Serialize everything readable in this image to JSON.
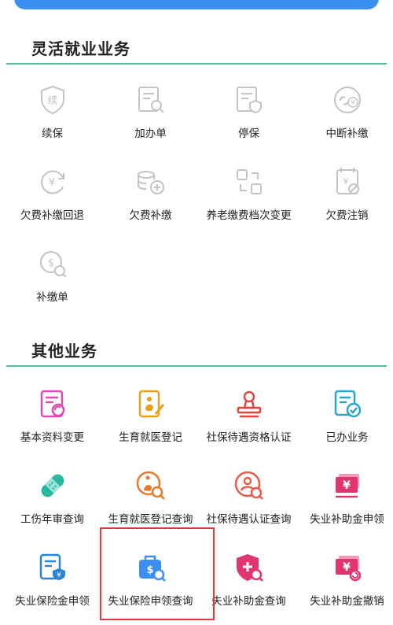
{
  "sections": {
    "flexible": {
      "title": "灵活就业业务",
      "items": [
        {
          "label": "续保",
          "icon": "renew-shield-icon"
        },
        {
          "label": "加办单",
          "icon": "add-form-search-icon"
        },
        {
          "label": "停保",
          "icon": "stop-insurance-icon"
        },
        {
          "label": "中断补缴",
          "icon": "interrupt-payment-icon"
        },
        {
          "label": "欠费补缴回退",
          "icon": "arrears-rollback-icon"
        },
        {
          "label": "欠费补缴",
          "icon": "arrears-payment-icon"
        },
        {
          "label": "养老缴费档次变更",
          "icon": "pension-level-change-icon"
        },
        {
          "label": "欠费注销",
          "icon": "arrears-cancel-icon"
        },
        {
          "label": "补缴单",
          "icon": "payment-form-icon"
        }
      ]
    },
    "other": {
      "title": "其他业务",
      "items": [
        {
          "label": "基本资料变更",
          "icon": "profile-change-icon"
        },
        {
          "label": "生育就医登记",
          "icon": "maternity-register-icon"
        },
        {
          "label": "社保待遇资格认证",
          "icon": "qualification-stamp-icon"
        },
        {
          "label": "已办业务",
          "icon": "done-business-icon"
        },
        {
          "label": "工伤年审查询",
          "icon": "injury-bandage-icon"
        },
        {
          "label": "生育就医登记查询",
          "icon": "maternity-query-icon"
        },
        {
          "label": "社保待遇认证查询",
          "icon": "certification-query-icon"
        },
        {
          "label": "失业补助金申领",
          "icon": "unemployment-subsidy-apply-icon"
        },
        {
          "label": "失业保险金申领",
          "icon": "unemployment-insurance-apply-icon"
        },
        {
          "label": "失业保险申领查询",
          "icon": "unemployment-insurance-query-icon"
        },
        {
          "label": "失业补助金查询",
          "icon": "unemployment-subsidy-query-icon"
        },
        {
          "label": "失业补助金撤销",
          "icon": "unemployment-subsidy-cancel-icon"
        }
      ]
    }
  },
  "colors": {
    "accent_bar": "#3b8ff0",
    "section_rule": "#5fb8a0",
    "disabled_icon": "#c4c4c4",
    "highlight_box": "#d9363e"
  }
}
